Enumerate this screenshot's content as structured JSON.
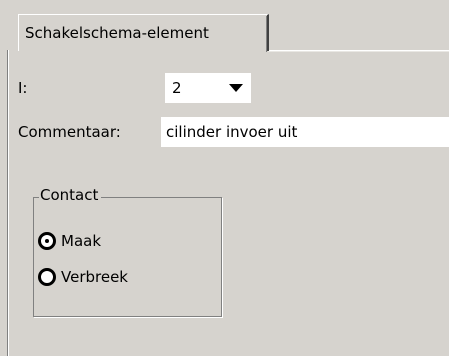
{
  "tab": {
    "label": "Schakelschema-element"
  },
  "fields": {
    "i_label": "I:",
    "i_value": "2",
    "comment_label": "Commentaar:",
    "comment_value": "cilinder invoer uit"
  },
  "contact": {
    "title": "Contact",
    "options": [
      {
        "label": "Maak",
        "selected": true
      },
      {
        "label": "Verbreek",
        "selected": false
      }
    ]
  }
}
